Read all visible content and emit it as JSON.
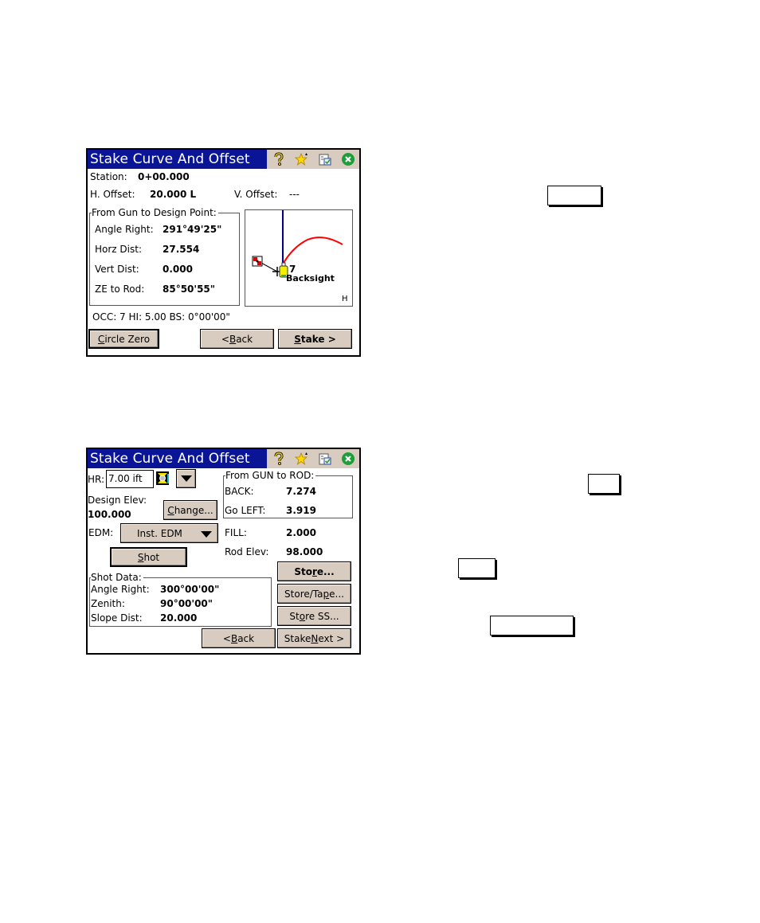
{
  "screen1": {
    "title": "Stake Curve And Offset",
    "title_icons": [
      "help-icon",
      "favorites-icon",
      "task-list-icon",
      "close-icon"
    ],
    "station_label": "Station:",
    "station_value": "0+00.000",
    "h_offset_label": "H. Offset:",
    "h_offset_value": "20.000 L",
    "v_offset_label": "V. Offset:",
    "v_offset_value": "---",
    "group_label": "From Gun to Design Point:",
    "rows": [
      {
        "label": "Angle Right:",
        "value": "291°49'25\""
      },
      {
        "label": "Horz Dist:",
        "value": "27.554"
      },
      {
        "label": "Vert Dist:",
        "value": "0.000"
      },
      {
        "label": "ZE to Rod:",
        "value": "85°50'55\""
      }
    ],
    "plot": {
      "point_label": "7",
      "backsight_label": "Backsight",
      "corner_label": "H",
      "curve_color": "#ff0000",
      "line_color": "#000080"
    },
    "status": "OCC: 7  HI: 5.00  BS: 0°00'00\"",
    "buttons": {
      "circle_zero": {
        "pre": "",
        "u": "C",
        "post": "ircle Zero"
      },
      "back": {
        "pre": "< ",
        "u": "B",
        "post": "ack"
      },
      "stake": {
        "pre": "",
        "u": "S",
        "post": "take >"
      }
    }
  },
  "screen2": {
    "title": "Stake Curve And Offset",
    "hr_label": "HR:",
    "hr_value": "7.00 ift",
    "design_elev_label": "Design Elev:",
    "design_elev_value": "100.000",
    "change_button": {
      "pre": "",
      "u": "C",
      "post": "hange..."
    },
    "edm_label": "EDM:",
    "edm_value": "Inst. EDM",
    "shot_button": {
      "pre": "",
      "u": "S",
      "post": "hot"
    },
    "gun_group_label": "From GUN to ROD:",
    "back_label": "BACK:",
    "back_value": "7.274",
    "left_label": "Go LEFT:",
    "left_value": "3.919",
    "fill_label": "FILL:",
    "fill_value": "2.000",
    "rod_elev_label": "Rod Elev:",
    "rod_elev_value": "98.000",
    "shot_group_label": "Shot Data:",
    "shot_rows": [
      {
        "label": "Angle Right:",
        "value": "300°00'00\""
      },
      {
        "label": "Zenith:",
        "value": "90°00'00\""
      },
      {
        "label": "Slope Dist:",
        "value": "20.000"
      }
    ],
    "buttons": {
      "store": {
        "pre": "Sto",
        "u": "r",
        "post": "e..."
      },
      "store_tape": {
        "pre": "Store/Ta",
        "u": "p",
        "post": "e..."
      },
      "store_ss": {
        "pre": "St",
        "u": "o",
        "post": "re SS..."
      },
      "back": {
        "pre": "< ",
        "u": "B",
        "post": "ack"
      },
      "stake_next": {
        "pre": "Stake ",
        "u": "N",
        "post": "ext >"
      }
    }
  },
  "colors": {
    "title_bg": "#0a1496",
    "button_bg": "#d8ccc0"
  }
}
